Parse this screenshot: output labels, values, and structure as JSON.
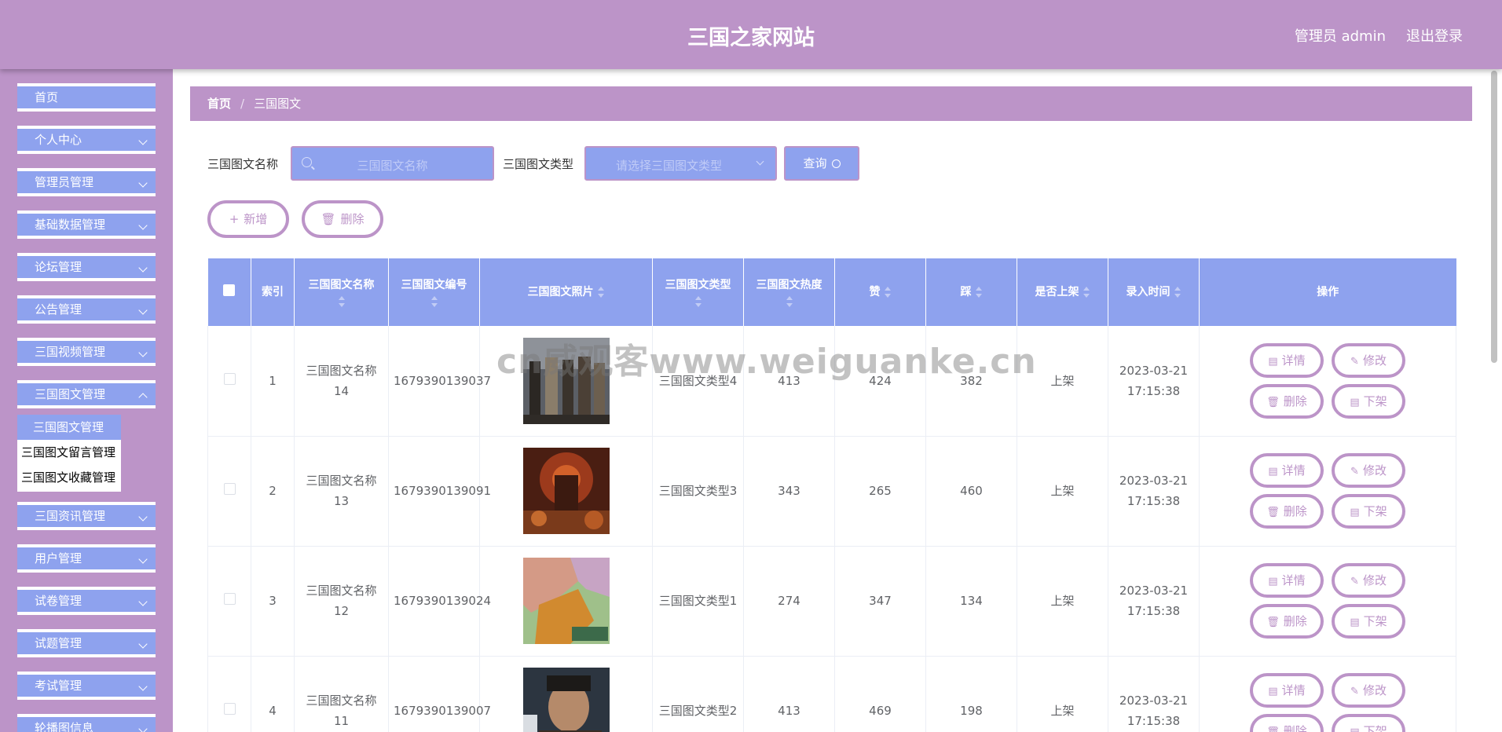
{
  "header": {
    "title": "三国之家网站",
    "admin": "管理员 admin",
    "logout": "退出登录"
  },
  "sidebar": {
    "items": [
      {
        "label": "首页"
      },
      {
        "label": "个人中心"
      },
      {
        "label": "管理员管理"
      },
      {
        "label": "基础数据管理"
      },
      {
        "label": "论坛管理"
      },
      {
        "label": "公告管理"
      },
      {
        "label": "三国视频管理"
      },
      {
        "label": "三国图文管理"
      },
      {
        "label": "三国资讯管理"
      },
      {
        "label": "用户管理"
      },
      {
        "label": "试卷管理"
      },
      {
        "label": "试题管理"
      },
      {
        "label": "考试管理"
      },
      {
        "label": "轮播图信息"
      }
    ],
    "submenu": [
      "三国图文管理",
      "三国图文留言管理",
      "三国图文收藏管理"
    ]
  },
  "breadcrumb": {
    "home": "首页",
    "sep": "/",
    "current": "三国图文"
  },
  "search": {
    "name_label": "三国图文名称",
    "name_placeholder": "三国图文名称",
    "type_label": "三国图文类型",
    "type_placeholder": "请选择三国图文类型",
    "query_label": "查询"
  },
  "actions": {
    "add": "新增",
    "delete": "删除"
  },
  "table": {
    "columns": [
      "索引",
      "三国图文名称",
      "三国图文编号",
      "三国图文照片",
      "三国图文类型",
      "三国图文热度",
      "赞",
      "踩",
      "是否上架",
      "录入时间",
      "操作"
    ],
    "rows": [
      {
        "index": "1",
        "name": "三国图文名称14",
        "code": "1679390139037",
        "type": "三国图文类型4",
        "heat": "413",
        "like": "424",
        "dislike": "382",
        "status": "上架",
        "time": "2023-03-21 17:15:38"
      },
      {
        "index": "2",
        "name": "三国图文名称13",
        "code": "1679390139091",
        "type": "三国图文类型3",
        "heat": "343",
        "like": "265",
        "dislike": "460",
        "status": "上架",
        "time": "2023-03-21 17:15:38"
      },
      {
        "index": "3",
        "name": "三国图文名称12",
        "code": "1679390139024",
        "type": "三国图文类型1",
        "heat": "274",
        "like": "347",
        "dislike": "134",
        "status": "上架",
        "time": "2023-03-21 17:15:38"
      },
      {
        "index": "4",
        "name": "三国图文名称11",
        "code": "1679390139007",
        "type": "三国图文类型2",
        "heat": "413",
        "like": "469",
        "dislike": "198",
        "status": "上架",
        "time": "2023-03-21 17:15:38"
      }
    ],
    "ops": {
      "detail": "详情",
      "edit": "修改",
      "delete": "删除",
      "offshelf": "下架"
    }
  },
  "watermark": "cn威观客www.weiguanke.cn",
  "colors": {
    "header": "#bc94c8",
    "accent": "#8ea2ee",
    "text": "#606266"
  }
}
